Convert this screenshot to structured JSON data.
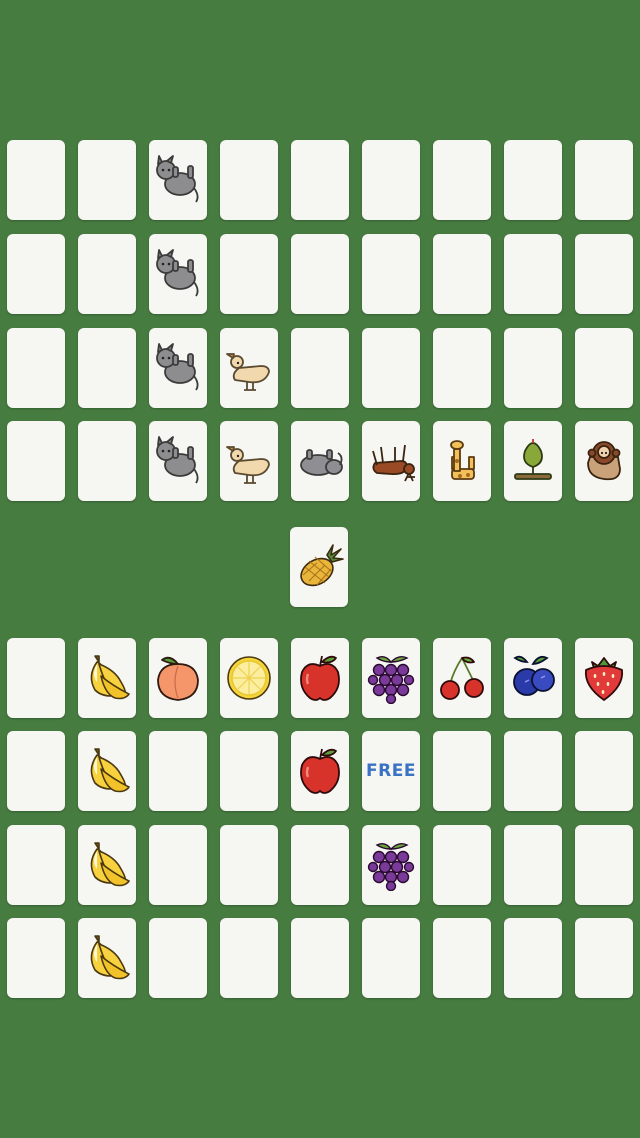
{
  "game": {
    "colors": {
      "felt": "#477c41",
      "card": "#f6f6f2",
      "free_text": "#3a72c4"
    },
    "opponent_board": {
      "columns": 9,
      "rows": [
        [
          "",
          "",
          "cat-icon",
          "",
          "",
          "",
          "",
          "",
          ""
        ],
        [
          "",
          "",
          "cat-icon",
          "",
          "",
          "",
          "",
          "",
          ""
        ],
        [
          "",
          "",
          "cat-icon",
          "duck-icon",
          "",
          "",
          "",
          "",
          ""
        ],
        [
          "",
          "",
          "cat-icon",
          "duck-icon",
          "elephant-icon",
          "deer-icon",
          "giraffe-icon",
          "snake-icon",
          "monkey-icon"
        ]
      ]
    },
    "draw_card": "pineapple-icon",
    "player_board": {
      "columns": 9,
      "rows": [
        [
          "",
          "banana-icon",
          "peach-icon",
          "lemon-icon",
          "apple-icon",
          "grapes-icon",
          "cherry-icon",
          "blueberry-icon",
          "strawberry-icon"
        ],
        [
          "",
          "banana-icon",
          "",
          "",
          "apple-icon",
          "FREE",
          "",
          "",
          ""
        ],
        [
          "",
          "banana-icon",
          "",
          "",
          "",
          "grapes-icon",
          "",
          "",
          ""
        ],
        [
          "",
          "banana-icon",
          "",
          "",
          "",
          "",
          "",
          "",
          ""
        ]
      ]
    },
    "free_label": "FREE"
  }
}
